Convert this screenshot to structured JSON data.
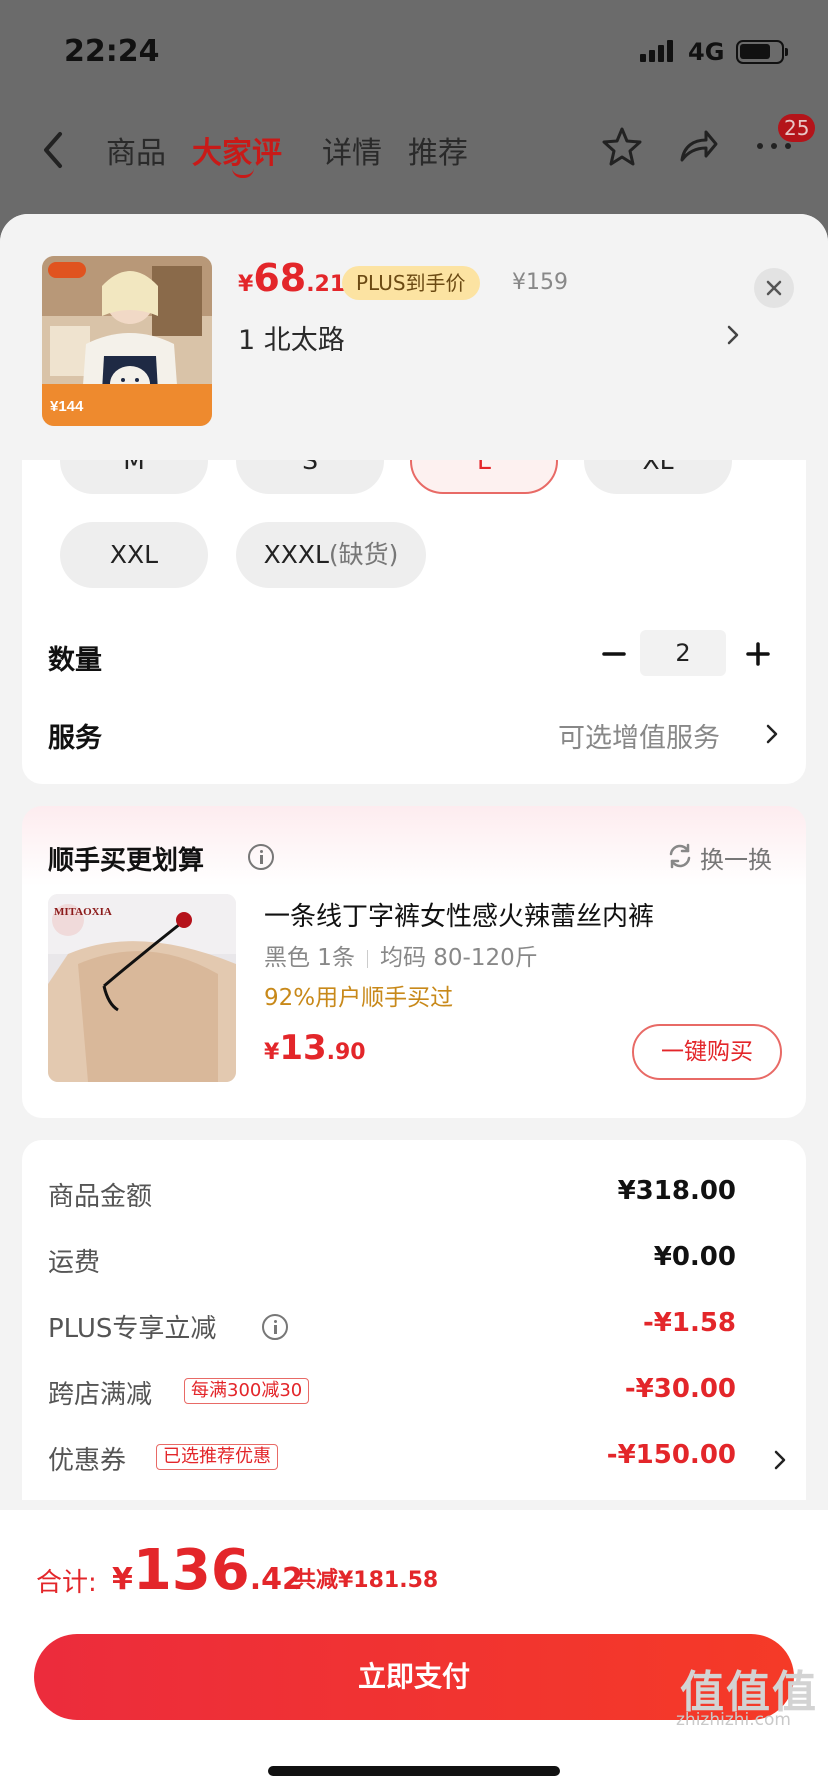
{
  "status": {
    "time": "22:24",
    "network": "4G"
  },
  "nav": {
    "tabs": [
      "商品",
      "大家评",
      "详情",
      "推荐"
    ],
    "active_tab": "大家评",
    "badge": "25"
  },
  "product": {
    "price_currency": "¥",
    "price_int": "68",
    "price_dec": ".21",
    "plus_tag": "PLUS到手价",
    "orig_price": "¥159",
    "address": "1  北太路",
    "thumb_stickers": [
      "¥144"
    ]
  },
  "sizes": [
    {
      "label": "M",
      "selected": false
    },
    {
      "label": "S",
      "selected": false
    },
    {
      "label": "L",
      "selected": true
    },
    {
      "label": "XL",
      "selected": false
    },
    {
      "label": "XXL",
      "selected": false
    },
    {
      "label": "XXXL",
      "suffix": "(缺货)",
      "selected": false
    }
  ],
  "quantity": {
    "label": "数量",
    "value": "2"
  },
  "service": {
    "label": "服务",
    "value": "可选增值服务"
  },
  "recommend": {
    "title": "顺手买更划算",
    "refresh": "换一换",
    "name": "一条线丁字裤女性感火辣蕾丝内裤",
    "spec_color": "黑色 1条",
    "spec_size": "均码 80-120斤",
    "percent": "92%用户顺手买过",
    "price_currency": "¥",
    "price_int": "13",
    "price_dec": ".90",
    "buy_label": "一键购买",
    "image_brand": "MITAOXIA"
  },
  "summary": [
    {
      "label": "商品金额",
      "value": "¥318.00",
      "red": false
    },
    {
      "label": "运费",
      "value": "¥0.00",
      "red": false
    },
    {
      "label": "PLUS专享立减",
      "value": "-¥1.58",
      "red": true
    },
    {
      "label": "跨店满减",
      "tag": "每满300减30",
      "value": "-¥30.00",
      "red": true
    },
    {
      "label": "优惠券",
      "tag": "已选推荐优惠",
      "value": "-¥150.00",
      "red": true
    }
  ],
  "total": {
    "label": "合计:",
    "currency": "¥",
    "int": "136",
    "dec": ".42",
    "saved": "共减¥181.58"
  },
  "pay_button": "立即支付",
  "watermark": {
    "logo": "值值值",
    "site": "zhizhizhi.com"
  },
  "colors": {
    "accent": "#e3262a",
    "plus_tag_bg": "#fce3a2",
    "pay_gradient_start": "#ec2c3c",
    "pay_gradient_end": "#f53a27"
  }
}
